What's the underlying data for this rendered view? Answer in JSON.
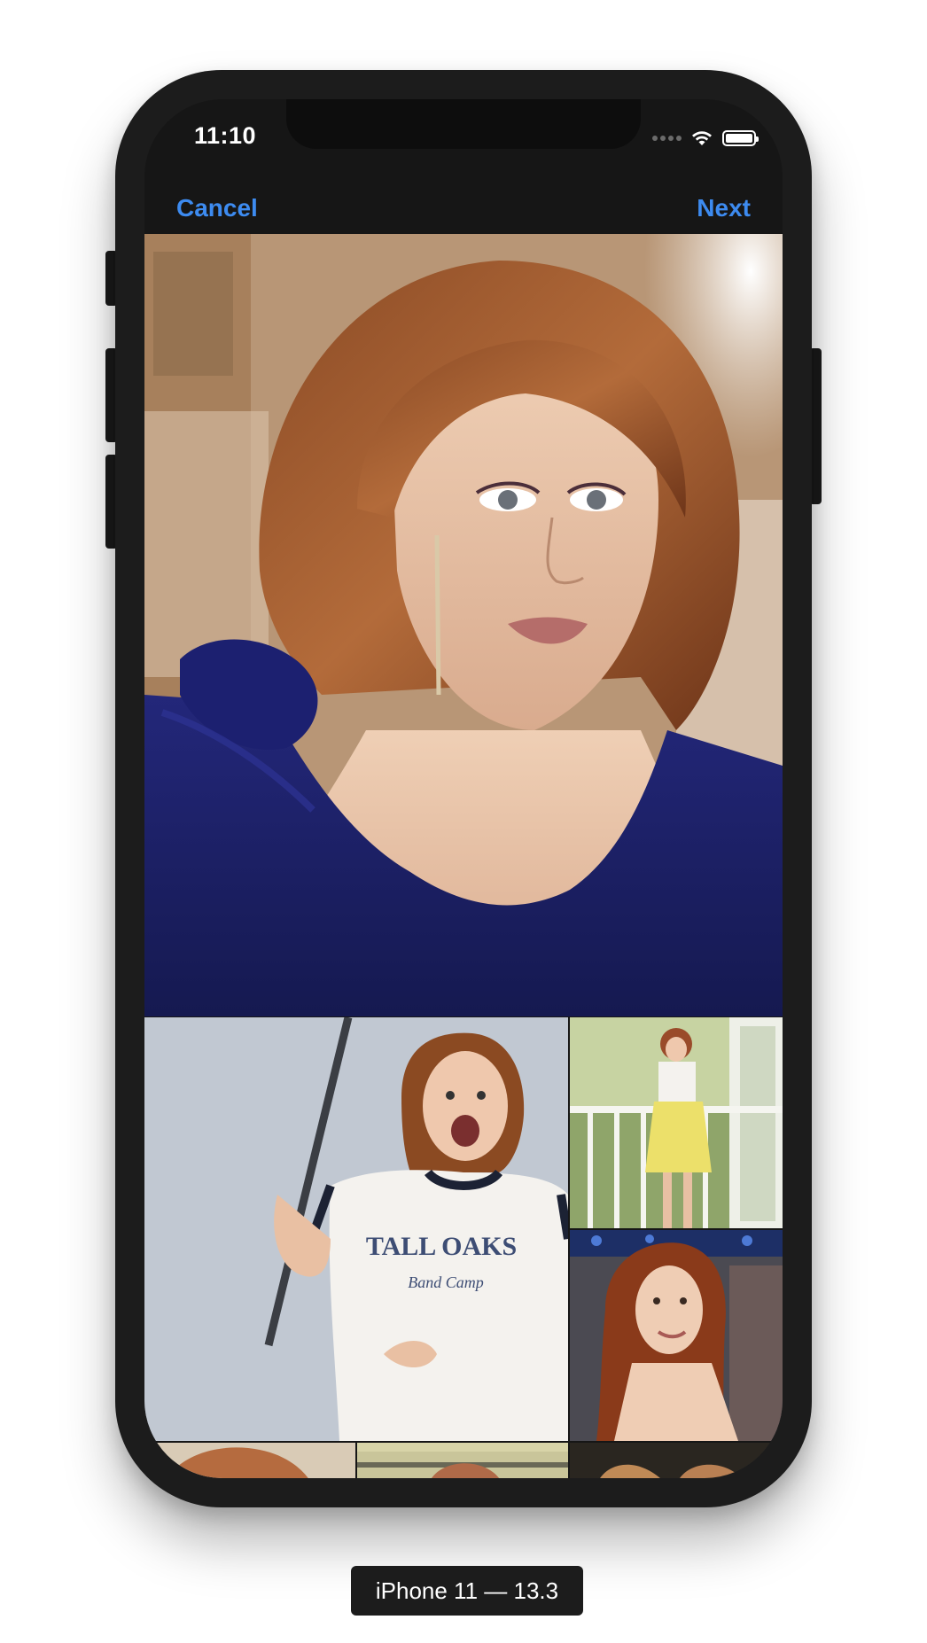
{
  "status_bar": {
    "time": "11:10",
    "icons": [
      "signal-dots-icon",
      "wifi-icon",
      "battery-icon"
    ]
  },
  "navbar": {
    "cancel_label": "Cancel",
    "next_label": "Next",
    "accent_color": "#3d8bf0"
  },
  "preview": {
    "description_icon": "photo-preview"
  },
  "grid": {
    "tiles": [
      "photo-tile",
      "photo-tile",
      "photo-tile",
      "photo-tile",
      "photo-tile",
      "photo-tile"
    ],
    "tall_oaks_text": "TALL OAKS",
    "band_camp_text": "Band Camp"
  },
  "device_label": "iPhone 11 — 13.3"
}
